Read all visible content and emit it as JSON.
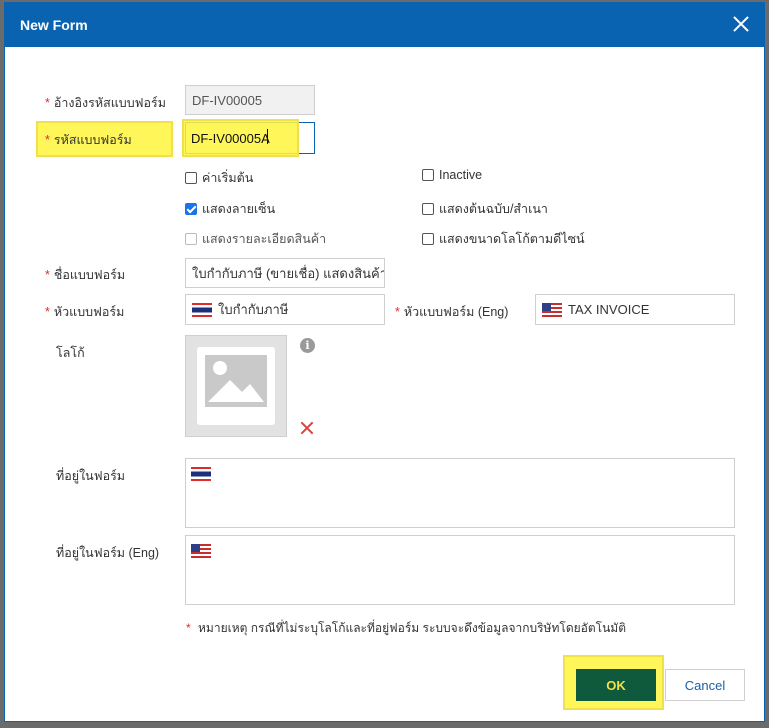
{
  "dialog": {
    "title": "New Form"
  },
  "fields": {
    "ref_code_label": "อ้างอิงรหัสแบบฟอร์ม",
    "ref_code_value": "DF-IV00005",
    "form_code_label": "รหัสแบบฟอร์ม",
    "form_code_value": "DF-IV00005A",
    "form_name_label": "ชื่อแบบฟอร์ม",
    "form_name_value": "ใบกำกับภาษี (ขายเชื่อ) แสดงสินค้า",
    "header_label": "หัวแบบฟอร์ม",
    "header_value": "ใบกำกับภาษี",
    "header_eng_label": "หัวแบบฟอร์ม (Eng)",
    "header_eng_value": "TAX INVOICE",
    "logo_label": "โลโก้",
    "address_label": "ที่อยู่ในฟอร์ม",
    "address_eng_label": "ที่อยู่ในฟอร์ม (Eng)"
  },
  "checkboxes": {
    "default": {
      "label": "ค่าเริ่มต้น",
      "checked": false
    },
    "inactive": {
      "label": "Inactive",
      "checked": false
    },
    "show_signature": {
      "label": "แสดงลายเซ็น",
      "checked": true
    },
    "show_original_copy": {
      "label": "แสดงต้นฉบับ/สำเนา",
      "checked": false
    },
    "show_item_detail": {
      "label": "แสดงรายละเอียดสินค้า",
      "checked": false,
      "disabled": true
    },
    "show_logo_by_design": {
      "label": "แสดงขนาดโลโก้ตามดีไซน์",
      "checked": false
    }
  },
  "icons": {
    "close": "close-icon",
    "info": "info-icon",
    "image_placeholder": "image-placeholder-icon",
    "remove": "remove-icon",
    "flag_th": "thai-flag-icon",
    "flag_us": "us-flag-icon"
  },
  "info_glyph": "i",
  "required_mark": "*",
  "note": {
    "mark": "*",
    "text": "หมายเหตุ กรณีที่ไม่ระบุโลโก้และที่อยู่ฟอร์ม ระบบจะดึงข้อมูลจากบริษัทโดยอัตโนมัติ"
  },
  "buttons": {
    "ok": "OK",
    "cancel": "Cancel"
  },
  "colors": {
    "titlebar": "#0a63b0",
    "required": "#d9302c",
    "ok_bg": "#0f5a3c",
    "highlight": "#fff53c"
  }
}
